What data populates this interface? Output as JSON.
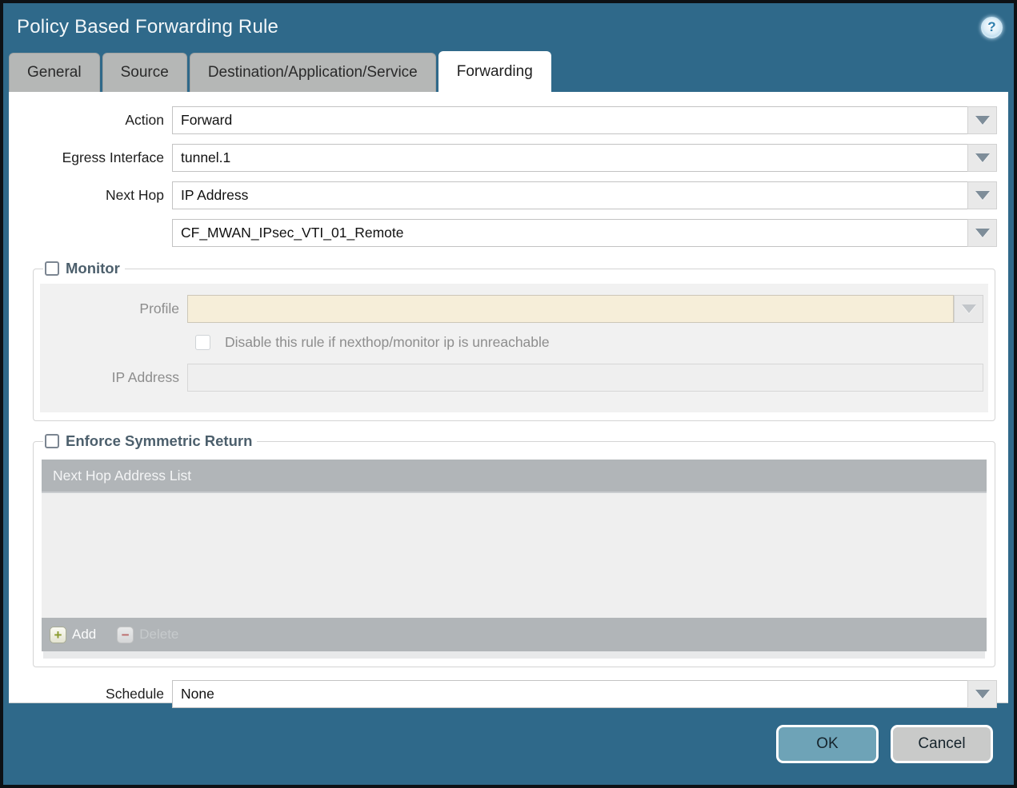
{
  "dialog": {
    "title": "Policy Based Forwarding Rule",
    "help_icon": "?"
  },
  "tabs": [
    {
      "label": "General",
      "active": false
    },
    {
      "label": "Source",
      "active": false
    },
    {
      "label": "Destination/Application/Service",
      "active": false
    },
    {
      "label": "Forwarding",
      "active": true
    }
  ],
  "form": {
    "action": {
      "label": "Action",
      "value": "Forward"
    },
    "egress_interface": {
      "label": "Egress Interface",
      "value": "tunnel.1"
    },
    "next_hop": {
      "label": "Next Hop",
      "value": "IP Address"
    },
    "next_hop_address": {
      "value": "CF_MWAN_IPsec_VTI_01_Remote"
    },
    "schedule": {
      "label": "Schedule",
      "value": "None"
    }
  },
  "monitor": {
    "legend": "Monitor",
    "checked": false,
    "profile": {
      "label": "Profile",
      "value": ""
    },
    "disable_rule": {
      "label": "Disable this rule if nexthop/monitor ip is unreachable",
      "checked": false
    },
    "ip_address": {
      "label": "IP Address",
      "value": ""
    }
  },
  "symmetric_return": {
    "legend": "Enforce Symmetric Return",
    "checked": false,
    "table_header": "Next Hop Address List",
    "rows": [],
    "add_label": "Add",
    "delete_label": "Delete",
    "add_icon": "+",
    "delete_icon": "−"
  },
  "footer": {
    "ok_label": "OK",
    "cancel_label": "Cancel"
  },
  "colors": {
    "titlebar_bg": "#2f698a",
    "active_tab_bg": "#ffffff",
    "inactive_tab_bg": "#b5b7b6",
    "disabled_field_bg": "#f6eed9",
    "table_header_bg": "#b1b5b8",
    "ok_button_bg": "#6ea3b7",
    "cancel_button_bg": "#c9cac9"
  }
}
